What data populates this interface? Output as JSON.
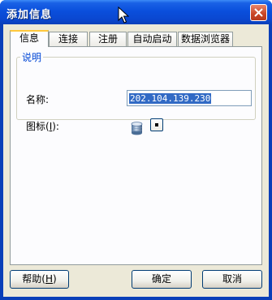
{
  "window": {
    "title": "添加信息"
  },
  "tabs": [
    {
      "label": "信息"
    },
    {
      "label": "连接"
    },
    {
      "label": "注册"
    },
    {
      "label": "自动启动"
    },
    {
      "label": "数据浏览器"
    }
  ],
  "info": {
    "group_title": "说明",
    "name_label": "名称:",
    "name_value": "202.104.139.230",
    "icon_label": "图标(I):",
    "icon_label_prefix": "图标(",
    "icon_label_key": "I",
    "icon_label_suffix": "):",
    "icon_name": "database-icon"
  },
  "buttons": {
    "help_prefix": "帮助(",
    "help_key": "H",
    "help_suffix": ")",
    "help": "帮助(H)",
    "ok": "确定",
    "cancel": "取消"
  },
  "colors": {
    "titlebar": "#0a4fdc",
    "client_bg": "#ece9d8",
    "selection": "#316ac5",
    "group_title": "#0046d5"
  }
}
